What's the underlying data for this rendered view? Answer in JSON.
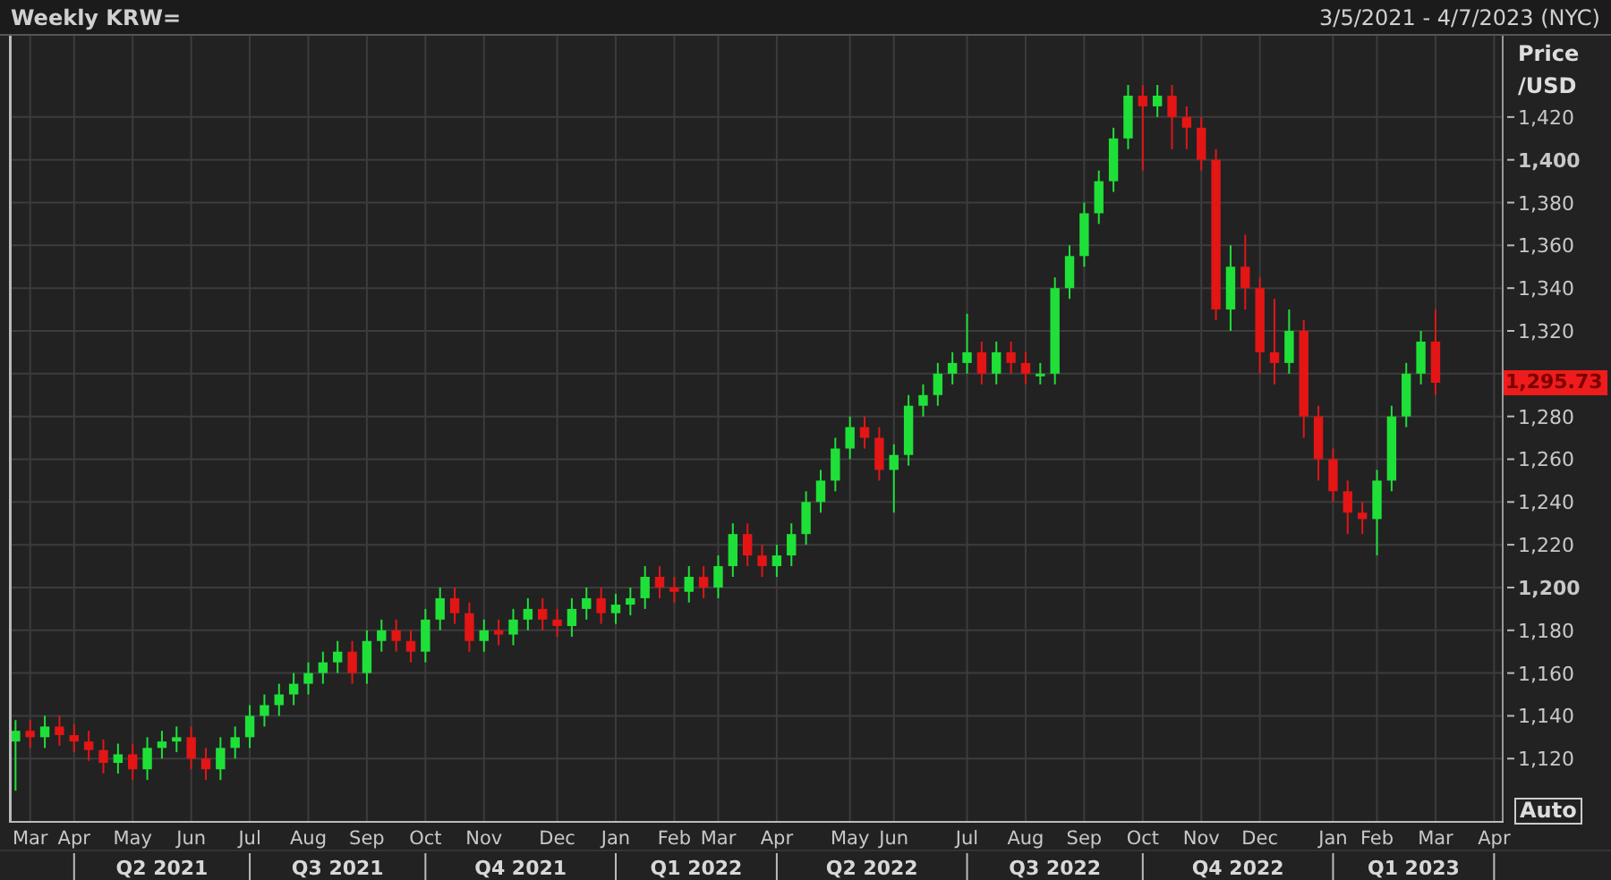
{
  "header": {
    "title": "Weekly KRW=",
    "date_range": "3/5/2021 - 4/7/2023 (NYC)"
  },
  "chart": {
    "chart_data": {
      "type": "candlestick",
      "ylabel": "Price /USD",
      "grid": true,
      "ylim": [
        1090,
        1458
      ],
      "categories": [
        null,
        "Mar",
        null,
        null,
        "Apr",
        null,
        null,
        null,
        "May",
        null,
        null,
        null,
        "Jun",
        null,
        null,
        null,
        "Jul",
        null,
        null,
        null,
        "Aug",
        null,
        null,
        null,
        "Sep",
        null,
        null,
        null,
        "Oct",
        null,
        null,
        null,
        "Nov",
        null,
        null,
        null,
        null,
        "Dec",
        null,
        null,
        null,
        "Jan",
        null,
        null,
        null,
        "Feb",
        null,
        null,
        "Mar",
        null,
        null,
        null,
        "Apr",
        null,
        null,
        null,
        null,
        "May",
        null,
        null,
        "Jun",
        null,
        null,
        null,
        null,
        "Jul",
        null,
        null,
        null,
        "Aug",
        null,
        null,
        null,
        "Sep",
        null,
        null,
        null,
        "Oct",
        null,
        null,
        null,
        "Nov",
        null,
        null,
        null,
        "Dec",
        null,
        null,
        null,
        null,
        "Jan",
        null,
        null,
        "Feb",
        null,
        null,
        null,
        "Mar",
        null,
        null,
        null,
        "Apr"
      ],
      "ohlc": [
        [
          1128,
          1138,
          1105,
          1133
        ],
        [
          1133,
          1138,
          1125,
          1130
        ],
        [
          1130,
          1140,
          1125,
          1135
        ],
        [
          1135,
          1140,
          1126,
          1131
        ],
        [
          1131,
          1136,
          1123,
          1128
        ],
        [
          1128,
          1133,
          1119,
          1124
        ],
        [
          1124,
          1129,
          1113,
          1118
        ],
        [
          1118,
          1127,
          1113,
          1122
        ],
        [
          1122,
          1127,
          1110,
          1115
        ],
        [
          1115,
          1130,
          1110,
          1125
        ],
        [
          1125,
          1133,
          1120,
          1128
        ],
        [
          1128,
          1135,
          1123,
          1130
        ],
        [
          1130,
          1135,
          1115,
          1120
        ],
        [
          1120,
          1125,
          1110,
          1115
        ],
        [
          1115,
          1130,
          1110,
          1125
        ],
        [
          1125,
          1135,
          1120,
          1130
        ],
        [
          1130,
          1145,
          1125,
          1140
        ],
        [
          1140,
          1150,
          1135,
          1145
        ],
        [
          1145,
          1155,
          1140,
          1150
        ],
        [
          1150,
          1160,
          1145,
          1155
        ],
        [
          1155,
          1165,
          1150,
          1160
        ],
        [
          1160,
          1170,
          1155,
          1165
        ],
        [
          1165,
          1175,
          1160,
          1170
        ],
        [
          1170,
          1175,
          1155,
          1160
        ],
        [
          1160,
          1180,
          1155,
          1175
        ],
        [
          1175,
          1185,
          1170,
          1180
        ],
        [
          1180,
          1185,
          1170,
          1175
        ],
        [
          1175,
          1180,
          1165,
          1170
        ],
        [
          1170,
          1190,
          1165,
          1185
        ],
        [
          1185,
          1200,
          1180,
          1195
        ],
        [
          1195,
          1200,
          1183,
          1188
        ],
        [
          1188,
          1193,
          1170,
          1175
        ],
        [
          1175,
          1185,
          1170,
          1180
        ],
        [
          1180,
          1185,
          1173,
          1178
        ],
        [
          1178,
          1190,
          1173,
          1185
        ],
        [
          1185,
          1195,
          1180,
          1190
        ],
        [
          1190,
          1195,
          1180,
          1185
        ],
        [
          1185,
          1190,
          1177,
          1182
        ],
        [
          1182,
          1195,
          1177,
          1190
        ],
        [
          1190,
          1200,
          1185,
          1195
        ],
        [
          1195,
          1200,
          1183,
          1188
        ],
        [
          1188,
          1197,
          1183,
          1192
        ],
        [
          1192,
          1200,
          1187,
          1195
        ],
        [
          1195,
          1210,
          1190,
          1205
        ],
        [
          1205,
          1210,
          1195,
          1200
        ],
        [
          1200,
          1205,
          1193,
          1198
        ],
        [
          1198,
          1210,
          1193,
          1205
        ],
        [
          1205,
          1210,
          1195,
          1200
        ],
        [
          1200,
          1215,
          1195,
          1210
        ],
        [
          1210,
          1230,
          1205,
          1225
        ],
        [
          1225,
          1230,
          1210,
          1215
        ],
        [
          1215,
          1220,
          1205,
          1210
        ],
        [
          1210,
          1220,
          1205,
          1215
        ],
        [
          1215,
          1230,
          1210,
          1225
        ],
        [
          1225,
          1245,
          1220,
          1240
        ],
        [
          1240,
          1255,
          1235,
          1250
        ],
        [
          1250,
          1270,
          1245,
          1265
        ],
        [
          1265,
          1280,
          1260,
          1275
        ],
        [
          1275,
          1280,
          1265,
          1270
        ],
        [
          1270,
          1275,
          1250,
          1255
        ],
        [
          1255,
          1267,
          1235,
          1262
        ],
        [
          1262,
          1290,
          1257,
          1285
        ],
        [
          1285,
          1295,
          1280,
          1290
        ],
        [
          1290,
          1305,
          1285,
          1300
        ],
        [
          1300,
          1310,
          1295,
          1305
        ],
        [
          1305,
          1328,
          1300,
          1310
        ],
        [
          1310,
          1315,
          1295,
          1300
        ],
        [
          1300,
          1315,
          1295,
          1310
        ],
        [
          1310,
          1315,
          1300,
          1305
        ],
        [
          1305,
          1310,
          1295,
          1300
        ],
        [
          1300,
          1305,
          1295,
          1300
        ],
        [
          1300,
          1345,
          1295,
          1340
        ],
        [
          1340,
          1360,
          1335,
          1355
        ],
        [
          1355,
          1380,
          1350,
          1375
        ],
        [
          1375,
          1395,
          1370,
          1390
        ],
        [
          1390,
          1415,
          1385,
          1410
        ],
        [
          1410,
          1435,
          1405,
          1430
        ],
        [
          1430,
          1435,
          1395,
          1425
        ],
        [
          1425,
          1435,
          1420,
          1430
        ],
        [
          1430,
          1435,
          1405,
          1420
        ],
        [
          1420,
          1425,
          1405,
          1415
        ],
        [
          1415,
          1420,
          1395,
          1400
        ],
        [
          1400,
          1405,
          1325,
          1330
        ],
        [
          1330,
          1360,
          1320,
          1350
        ],
        [
          1350,
          1365,
          1330,
          1340
        ],
        [
          1340,
          1345,
          1300,
          1310
        ],
        [
          1310,
          1335,
          1295,
          1305
        ],
        [
          1305,
          1330,
          1300,
          1320
        ],
        [
          1320,
          1325,
          1270,
          1280
        ],
        [
          1280,
          1285,
          1250,
          1260
        ],
        [
          1260,
          1265,
          1240,
          1245
        ],
        [
          1245,
          1250,
          1225,
          1235
        ],
        [
          1235,
          1240,
          1225,
          1232
        ],
        [
          1232,
          1255,
          1215,
          1250
        ],
        [
          1250,
          1285,
          1245,
          1280
        ],
        [
          1280,
          1305,
          1275,
          1300
        ],
        [
          1300,
          1320,
          1295,
          1315
        ],
        [
          1315,
          1330,
          1290,
          1295.73
        ],
        null,
        null,
        null,
        null
      ],
      "yticks": [
        {
          "value": 1120,
          "label": "1,120"
        },
        {
          "value": 1140,
          "label": "1,140"
        },
        {
          "value": 1160,
          "label": "1,160"
        },
        {
          "value": 1180,
          "label": "1,180"
        },
        {
          "value": 1200,
          "label": "1,200"
        },
        {
          "value": 1220,
          "label": "1,220"
        },
        {
          "value": 1240,
          "label": "1,240"
        },
        {
          "value": 1260,
          "label": "1,260"
        },
        {
          "value": 1280,
          "label": "1,280"
        },
        {
          "value": 1320,
          "label": "1,320"
        },
        {
          "value": 1340,
          "label": "1,340"
        },
        {
          "value": 1360,
          "label": "1,360"
        },
        {
          "value": 1380,
          "label": "1,380"
        },
        {
          "value": 1400,
          "label": "1,400"
        },
        {
          "value": 1420,
          "label": "1,420"
        }
      ]
    },
    "last_price": "1,295.73",
    "quarters": [
      "Q2 2021",
      "Q3 2021",
      "Q4 2021",
      "Q1 2022",
      "Q2 2022",
      "Q3 2022",
      "Q4 2022",
      "Q1 2023"
    ],
    "auto_button": "Auto"
  }
}
